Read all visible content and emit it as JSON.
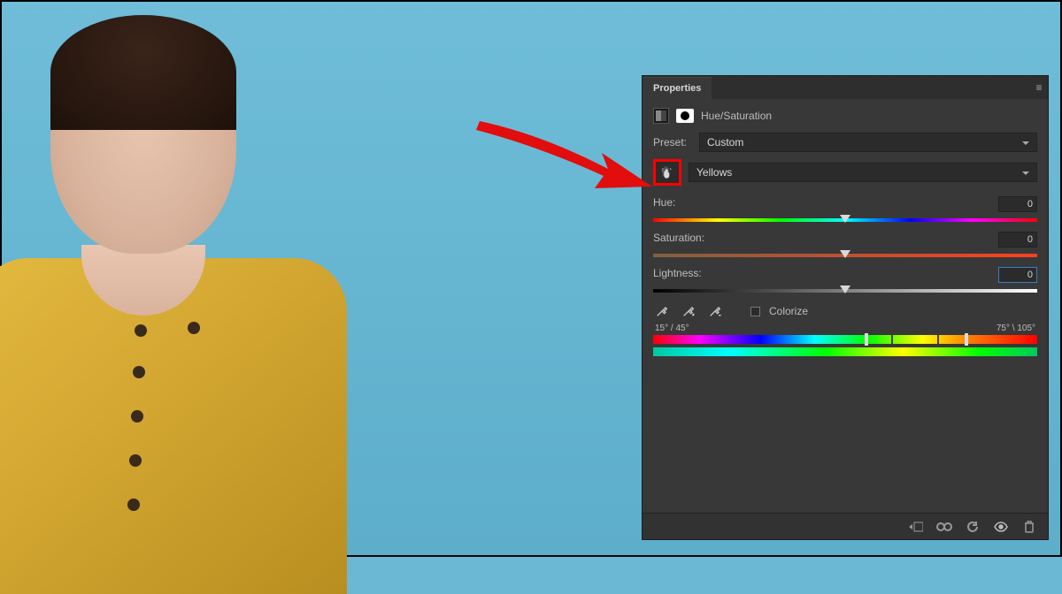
{
  "panel": {
    "tab_label": "Properties",
    "adjustment_name": "Hue/Saturation",
    "preset_label": "Preset:",
    "preset_value": "Custom",
    "channel_value": "Yellows",
    "sliders": {
      "hue": {
        "label": "Hue:",
        "value": "0"
      },
      "saturation": {
        "label": "Saturation:",
        "value": "0"
      },
      "lightness": {
        "label": "Lightness:",
        "value": "0"
      }
    },
    "colorize_label": "Colorize",
    "range": {
      "left": "15° / 45°",
      "right": "75° \\ 105°"
    }
  }
}
